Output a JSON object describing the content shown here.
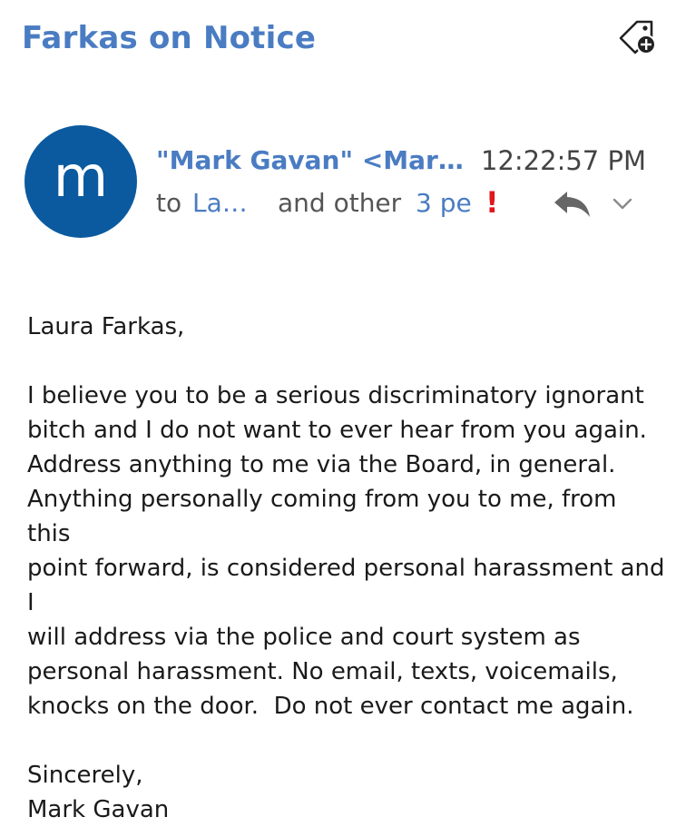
{
  "email": {
    "subject": "Farkas on Notice",
    "avatar_letter": "m",
    "avatar_color": "#0b5aa0",
    "sender": "\"Mark Gavan\" <Mark…",
    "time": "12:22:57 PM",
    "to_label": "to",
    "to_recipient": "Lau…",
    "and_other": "and other",
    "others_link": "3 pe",
    "importance_mark": "!",
    "accent_color": "#4a7cc2",
    "importance_color": "#e0161d",
    "icons": {
      "tag": "tag-add-icon",
      "reply": "reply-icon",
      "more": "chevron-down-icon"
    }
  },
  "body": {
    "salutation": "Laura Farkas,",
    "lines": [
      "I believe you to be a serious discriminatory ignorant",
      "bitch and I do not want to ever hear from you again.",
      "Address anything to me via the Board, in general.",
      "Anything personally coming from you to me, from this",
      "point forward, is considered personal harassment and I",
      "will address via the police and court system as",
      "personal harassment. No email, texts, voicemails,",
      "knocks on the door.  Do not ever contact me again."
    ],
    "closing": "Sincerely,",
    "signature": "Mark Gavan"
  }
}
